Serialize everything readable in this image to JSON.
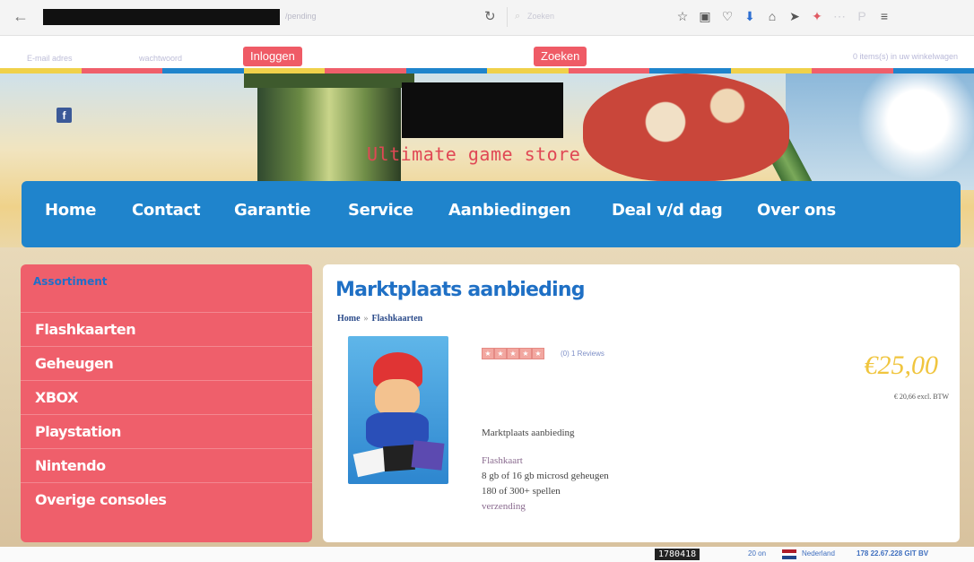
{
  "browser": {
    "url_tail": "/pending",
    "search_placeholder": "Zoeken",
    "toolbar_icons": [
      "star-icon",
      "clipboard-icon",
      "pocket-icon",
      "download-icon",
      "home-icon",
      "send-icon",
      "addon-icon",
      "addon-icon",
      "extension-icon",
      "menu-icon"
    ]
  },
  "login": {
    "email_placeholder": "E-mail adres",
    "password_placeholder": "wachtwoord",
    "login_button": "Inloggen",
    "search_button": "Zoeken",
    "forgot": "0 items(s) in uw winkelwagen"
  },
  "colors": {
    "accent_red": "#ef5f6b",
    "nav_blue": "#1f84cc",
    "price_yellow": "#f0c53e"
  },
  "banner": {
    "tagline": "Ultimate game store"
  },
  "nav": {
    "items": [
      "Home",
      "Contact",
      "Garantie",
      "Service",
      "Aanbiedingen",
      "Deal v/d dag",
      "Over ons"
    ]
  },
  "sidebar": {
    "title": "Assortiment",
    "items": [
      "Flashkaarten",
      "Geheugen",
      "XBOX",
      "Playstation",
      "Nintendo",
      "Overige consoles"
    ]
  },
  "product": {
    "title": "Marktplaats aanbieding",
    "breadcrumb": [
      "Home",
      "Flashkaarten"
    ],
    "reviews": "(0) 1 Reviews",
    "price": "€25,00",
    "vat_note": "€ 20,66 excl. BTW",
    "desc_title": "Marktplaats aanbieding",
    "desc_type": "Flashkaart",
    "desc_memory": "8 gb of 16 gb  microsd geheugen",
    "desc_games": "180 of 300+  spellen",
    "desc_shipping": "verzending"
  },
  "status": {
    "counter": "1780418",
    "online": "20 on",
    "country": "Nederland",
    "ip": "178 22.67.228 GIT BV"
  }
}
